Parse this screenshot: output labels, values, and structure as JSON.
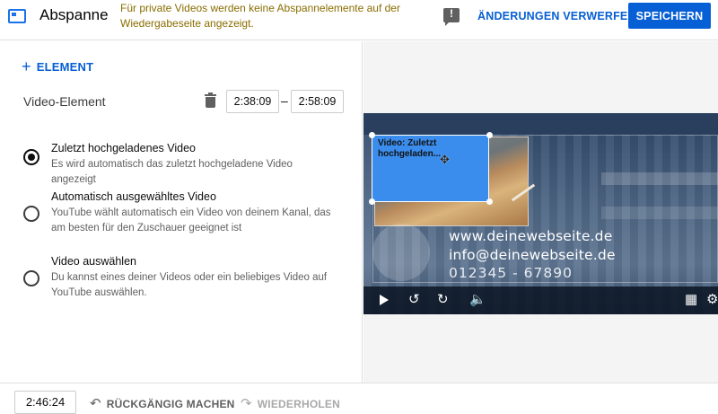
{
  "header": {
    "title": "Abspanne",
    "warning": "Für private Videos werden keine Abspannelemente auf der Wiedergabeseite angezeigt.",
    "discard_label": "ÄNDERUNGEN VERWERFEN",
    "save_label": "SPEICHERN",
    "accent_color": "#065fd4"
  },
  "editor": {
    "add_element_label": "ELEMENT",
    "element_label": "Video-Element",
    "start_time": "2:38:09",
    "end_time": "2:58:09",
    "time_separator": "–",
    "options": [
      {
        "title": "Zuletzt hochgeladenes Video",
        "desc": "Es wird automatisch das zuletzt hochgeladene Video angezeigt",
        "selected": true
      },
      {
        "title": "Automatisch ausgewähltes Video",
        "desc": "YouTube wählt automatisch ein Video von deinem Kanal, das am besten für den Zuschauer geeignet ist",
        "selected": false
      },
      {
        "title": "Video auswählen",
        "desc": "Du kannst eines deiner Videos oder ein beliebiges Video auf YouTube auswählen.",
        "selected": false
      }
    ]
  },
  "preview": {
    "element_label": "Video: Zuletzt hochgeladen...",
    "lines": [
      "www.deinewebseite.de",
      "info@deinewebseite.de",
      "012345 - 67890"
    ],
    "controls": [
      "play-icon",
      "rewind-10-icon",
      "forward-10-icon",
      "volume-icon",
      "grid-icon",
      "gear-icon"
    ]
  },
  "footer": {
    "current_time": "2:46:24",
    "undo_label": "RÜCKGÄNGIG MACHEN",
    "redo_label": "WIEDERHOLEN"
  }
}
